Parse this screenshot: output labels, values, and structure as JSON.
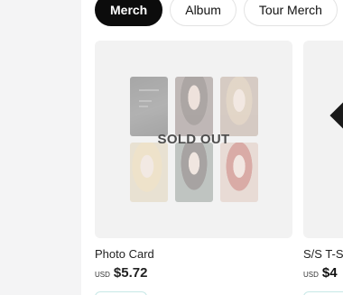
{
  "tabs": [
    {
      "label": "Merch",
      "active": true
    },
    {
      "label": "Album",
      "active": false
    },
    {
      "label": "Tour Merch",
      "active": false
    }
  ],
  "products": [
    {
      "name": "Photo Card",
      "currency": "USD",
      "price": "$5.72",
      "status": "SOLD OUT",
      "image": "photo-card-collage"
    },
    {
      "name": "S/S T-S",
      "currency": "USD",
      "price": "$4",
      "status": "",
      "image": "t-shirt"
    }
  ],
  "colors": {
    "active_tab": "#0c0c0c",
    "card_bg": "#f2f2f2",
    "button_border": "#c7e8e6"
  }
}
